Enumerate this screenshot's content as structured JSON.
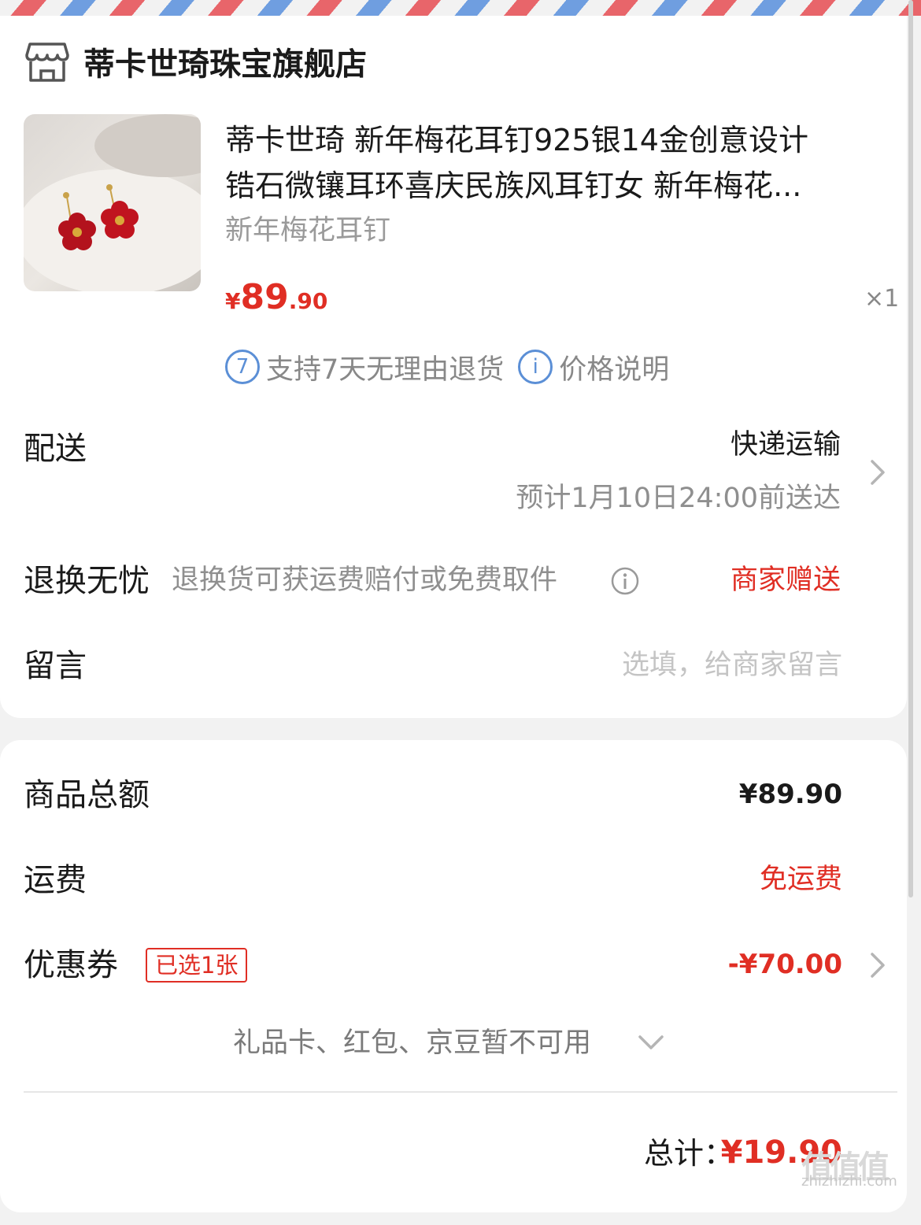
{
  "store": {
    "name": "蒂卡世琦珠宝旗舰店",
    "icon": "store-icon"
  },
  "product": {
    "title_line1": "蒂卡世琦 新年梅花耳钉925银14金创意设计",
    "title_line2": "锆石微镶耳环喜庆民族风耳钉女 新年梅花...",
    "variant": "新年梅花耳钉",
    "price_symbol": "¥",
    "price_integer": "89",
    "price_decimal": ".90",
    "quantity": "×1",
    "image_icon": "plum-blossom-earring-image"
  },
  "services": {
    "return_badge": "7",
    "return_text": "支持7天无理由退货",
    "price_badge": "i",
    "price_text": "价格说明"
  },
  "delivery": {
    "label": "配送",
    "method": "快递运输",
    "eta": "预计1月10日24:00前送达"
  },
  "return_worry_free": {
    "label": "退换无忧",
    "description": "退换货可获运费赔付或免费取件",
    "badge": "商家赠送"
  },
  "message": {
    "label": "留言",
    "placeholder": "选填，给商家留言"
  },
  "summary": {
    "goods_total_label": "商品总额",
    "goods_total_value": "¥89.90",
    "shipping_label": "运费",
    "shipping_value": "免运费",
    "coupon_label": "优惠券",
    "coupon_tag": "已选1张",
    "coupon_value": "-¥70.00",
    "unavailable_text": "礼品卡、红包、京豆暂不可用",
    "total_label": "总计：",
    "total_value": "¥19.90"
  },
  "watermark": {
    "logo": "值值值",
    "site": "zhizhizhi.com"
  },
  "colors": {
    "accent_red": "#e02e24",
    "badge_blue": "#5b8fd6",
    "muted_grey": "#8f8f8f"
  }
}
